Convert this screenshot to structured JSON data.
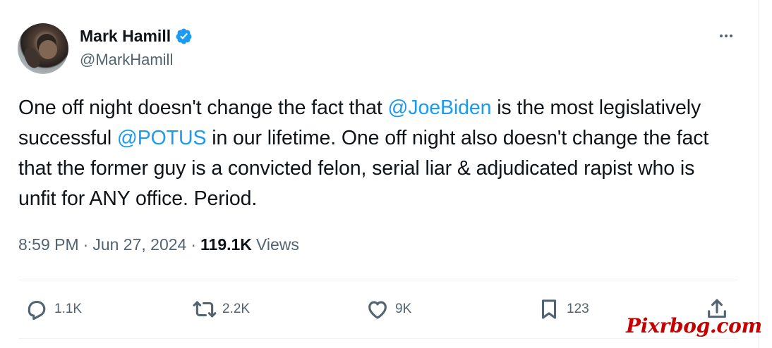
{
  "user": {
    "display_name": "Mark Hamill",
    "handle": "@MarkHamill",
    "verified": true,
    "verified_icon": "verified-badge-icon",
    "accent_color": "#1d9bf0"
  },
  "tweet": {
    "segments": [
      "One off night doesn't change the fact that ",
      "@JoeBiden",
      " is the most legislatively successful ",
      "@POTUS",
      " in our lifetime. One off night also doesn't change the fact that the former guy is a convicted felon, serial liar & adjudicated rapist who is unfit for ANY office. Period."
    ]
  },
  "meta": {
    "time": "8:59 PM",
    "date": "Jun 27, 2024",
    "views_count": "119.1K",
    "views_label": "Views",
    "separator": "·"
  },
  "actions": {
    "reply_count": "1.1K",
    "retweet_count": "2.2K",
    "like_count": "9K",
    "bookmark_count": "123",
    "icons": [
      "reply-icon",
      "retweet-icon",
      "like-icon",
      "bookmark-icon",
      "share-icon"
    ]
  },
  "watermark": {
    "text": "Pixrbog.com"
  }
}
